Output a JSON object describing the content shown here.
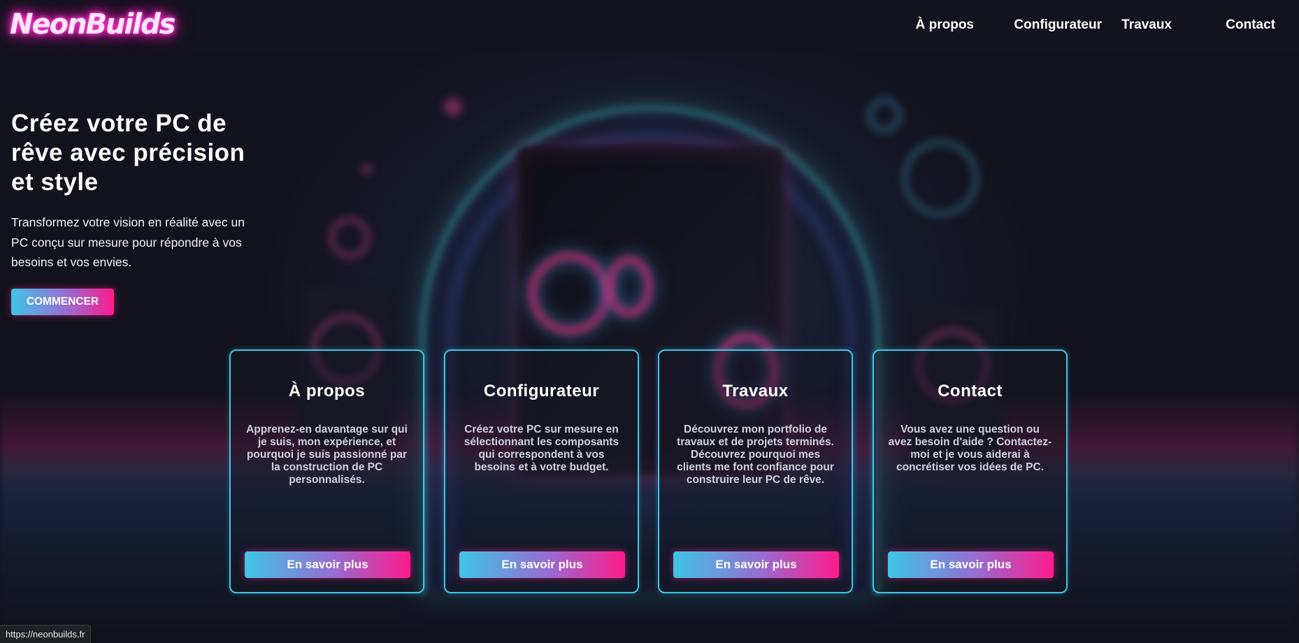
{
  "brand": {
    "logo": "NeonBuilds"
  },
  "nav": {
    "items": [
      {
        "label": "À propos"
      },
      {
        "label": "Configurateur"
      },
      {
        "label": "Travaux"
      },
      {
        "label": "Contact"
      }
    ]
  },
  "hero": {
    "title": "Créez votre PC de rêve avec précision et style",
    "subtitle": "Transformez votre vision en réalité avec un PC conçu sur mesure pour répondre à vos besoins et vos envies.",
    "cta": "COMMENCER"
  },
  "cards": [
    {
      "title": "À propos",
      "text": "Apprenez-en davantage sur qui je suis, mon expérience, et pourquoi je suis passionné par la construction de PC personnalisés.",
      "button": "En savoir plus"
    },
    {
      "title": "Configurateur",
      "text": "Créez votre PC sur mesure en sélectionnant les composants qui correspondent à vos besoins et à votre budget.",
      "button": "En savoir plus"
    },
    {
      "title": "Travaux",
      "text": "Découvrez mon portfolio de travaux et de projets terminés. Découvrez pourquoi mes clients me font confiance pour construire leur PC de rêve.",
      "button": "En savoir plus"
    },
    {
      "title": "Contact",
      "text": "Vous avez une question ou avez besoin d'aide ? Contactez-moi et je vous aiderai à concrétiser vos idées de PC.",
      "button": "En savoir plus"
    }
  ],
  "status_bar": {
    "url": "https://neonbuilds.fr"
  },
  "colors": {
    "accent_cyan": "#3fc6e6",
    "accent_pink": "#ff1a8c",
    "background": "#14151f"
  }
}
